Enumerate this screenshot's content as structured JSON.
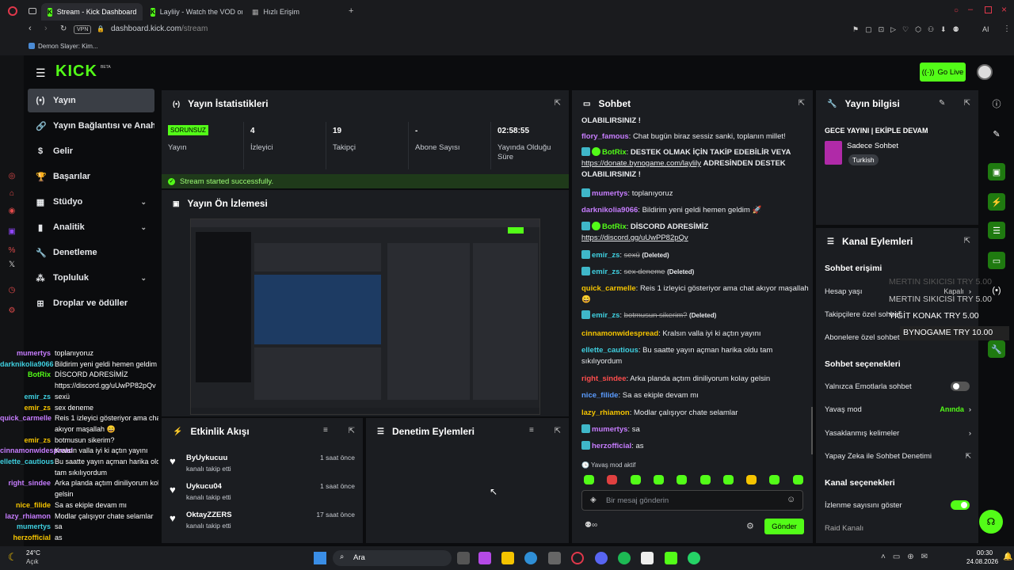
{
  "browser": {
    "tabs": [
      {
        "title": "Stream - Kick Dashboard"
      },
      {
        "title": "Layliiy - Watch the VOD on"
      },
      {
        "title": "Hızlı Erişim"
      }
    ],
    "vpn_label": "VPN",
    "url_domain": "dashboard.kick.com",
    "url_path": "/stream",
    "bookmark": "Demon Slayer: Kim...",
    "ai_label": "AI"
  },
  "app": {
    "logo": "KICK",
    "logo_beta": "BETA",
    "go_live": "Go Live",
    "accent": "#53fc18"
  },
  "nav": [
    {
      "label": "Yayın",
      "icon": "broadcast-icon"
    },
    {
      "label": "Yayın Bağlantısı ve Anahtarı",
      "icon": "link-icon"
    },
    {
      "label": "Gelir",
      "icon": "dollar-icon"
    },
    {
      "label": "Başarılar",
      "icon": "trophy-icon"
    },
    {
      "label": "Stüdyo",
      "icon": "studio-icon"
    },
    {
      "label": "Analitik",
      "icon": "analytics-icon"
    },
    {
      "label": "Denetleme",
      "icon": "wrench-icon"
    },
    {
      "label": "Topluluk",
      "icon": "community-icon"
    },
    {
      "label": "Droplar ve ödüller",
      "icon": "drops-icon"
    }
  ],
  "stats": {
    "title": "Yayın İstatistikleri",
    "items": [
      {
        "value": "SORUNSUZ",
        "label": "Yayın"
      },
      {
        "value": "4",
        "label": "İzleyici"
      },
      {
        "value": "19",
        "label": "Takipçi"
      },
      {
        "value": "-",
        "label": "Abone Sayısı"
      },
      {
        "value": "02:58:55",
        "label": "Yayında Olduğu Süre"
      }
    ],
    "success": "Stream started successfully."
  },
  "preview": {
    "title": "Yayın Ön İzlemesi"
  },
  "activity": {
    "title": "Etkinlik Akışı",
    "items": [
      {
        "name": "ByUykucuu",
        "desc": "kanalı takip etti",
        "time": "1 saat önce"
      },
      {
        "name": "Uykucu04",
        "desc": "kanalı takip etti",
        "time": "1 saat önce"
      },
      {
        "name": "OktayZZERS",
        "desc": "kanalı takip etti",
        "time": "17 saat önce"
      }
    ]
  },
  "mod_actions": {
    "title": "Denetim Eylemleri"
  },
  "chat": {
    "title": "Sohbet",
    "top_text": "OLABILIRSINIZ !",
    "messages": [
      {
        "user": "flory_famous",
        "color": "#c77dff",
        "text": "Chat bugün biraz sessiz sanki, toplanın millet!"
      },
      {
        "user": "BotRix",
        "color": "#53fc18",
        "text": "DESTEK OLMAK İÇİN TAKİP EDEBİLİR VEYA",
        "link": "https://donate.bynogame.com/laylily",
        "after": "ADRESİNDEN DESTEK OLABILIRSINIZ !"
      },
      {
        "user": "mumertys",
        "color": "#c77dff",
        "text": "toplanıyoruz"
      },
      {
        "user": "darknikolia9066",
        "color": "#c77dff",
        "text": "Bildirim yeni geldi hemen geldim 🚀"
      },
      {
        "user": "BotRix",
        "color": "#53fc18",
        "text": "DİSCORD ADRESİMİZ",
        "link": "https://discord.gg/uUwPP82pQv"
      },
      {
        "user": "emir_zs",
        "color": "#3fd0e0",
        "text": "sexü",
        "deleted": "(Deleted)"
      },
      {
        "user": "emir_zs",
        "color": "#3fd0e0",
        "text": "sex deneme",
        "deleted": "(Deleted)"
      },
      {
        "user": "quick_carmelle",
        "color": "#f5c400",
        "text": "Reis 1 izleyici gösteriyor ama chat akıyor maşallah 😄"
      },
      {
        "user": "emir_zs",
        "color": "#3fd0e0",
        "text": "botmusun sikerim?",
        "deleted": "(Deleted)"
      },
      {
        "user": "cinnamonwidespread",
        "color": "#f5c400",
        "text": "Kralsın valla iyi ki açtın yayını"
      },
      {
        "user": "ellette_cautious",
        "color": "#3fd0e0",
        "text": "Bu saatte yayın açman harika oldu tam sıkılıyordum"
      },
      {
        "user": "right_sindee",
        "color": "#ff4d4d",
        "text": "Arka planda açtım diniliyorum kolay gelsin"
      },
      {
        "user": "nice_filide",
        "color": "#5b9cff",
        "text": "Sa as ekiple devam mı"
      },
      {
        "user": "lazy_rhiamon",
        "color": "#f5c400",
        "text": "Modlar çalışıyor chate selamlar"
      },
      {
        "user": "mumertys",
        "color": "#c77dff",
        "text": "sa"
      },
      {
        "user": "herzofficial",
        "color": "#c77dff",
        "text": "as"
      }
    ],
    "slow_mode": "Yavaş mod aktif",
    "input_placeholder": "Bir mesaj gönderin",
    "send_label": "Gönder"
  },
  "stream_info": {
    "title": "Yayın bilgisi",
    "stream_title": "GECE YAYINI | EKİPLE DEVAM",
    "category": "Sadece Sohbet",
    "language": "Turkish"
  },
  "channel_actions": {
    "title": "Kanal Eylemleri",
    "chat_access": "Sohbet erişimi",
    "account_age": "Hesap yaşı",
    "account_age_value": "Kapalı",
    "followers_only": "Takipçilere özel sohbet",
    "subs_only": "Abonelere özel sohbet",
    "chat_options": "Sohbet seçenekleri",
    "emotes_only": "Yalnızca Emotlarla sohbet",
    "slow_mode": "Yavaş mod",
    "slow_mode_value": "Anında",
    "banned_words": "Yasaklanmış kelimeler",
    "ai_moderation": "Yapay Zeka ile Sohbet Denetimi",
    "channel_options": "Kanal seçenekleri",
    "show_viewers": "İzlenme sayısını göster",
    "raid": "Raid Kanalı"
  },
  "donations": [
    {
      "text": "MERTIN SIKICISI  TRY 5.00",
      "faded": true
    },
    {
      "text": "MERTIN SIKICISI  TRY 5.00",
      "faded": false
    },
    {
      "text": "YİĞİT KONAK  TRY 5.00",
      "faded": false
    },
    {
      "text": "BYNOGAME  TRY 10.00",
      "faded": false
    }
  ],
  "overlay_chat": [
    {
      "user": "mumertys",
      "text": "toplanıyoruz"
    },
    {
      "user": "darknikolia9066",
      "text": "Bildirim yeni geldi hemen geldim 🚀"
    },
    {
      "user": "BotRix",
      "text": "DİSCORD ADRESİMİZ"
    },
    {
      "user": "",
      "text": "https://discord.gg/uUwPP82pQv"
    },
    {
      "user": "emir_zs",
      "text": "sexü"
    },
    {
      "user": "emir_zs",
      "text": "sex deneme"
    },
    {
      "user": "quick_carmelle",
      "text": "Reis 1 izleyici gösteriyor ama chat"
    },
    {
      "user": "",
      "text": "akıyor maşallah 😄"
    },
    {
      "user": "emir_zs",
      "text": "botmusun sikerim?"
    },
    {
      "user": "cinnamonwidespread",
      "text": "Kralsın valla iyi ki açtın yayını"
    },
    {
      "user": "ellette_cautious",
      "text": "Bu saatte yayın açman harika oldu"
    },
    {
      "user": "",
      "text": "tam sıkılıyordum"
    },
    {
      "user": "right_sindee",
      "text": "Arka planda açtım diniliyorum kolay"
    },
    {
      "user": "",
      "text": "gelsin"
    },
    {
      "user": "nice_filide",
      "text": "Sa as ekiple devam mı"
    },
    {
      "user": "lazy_rhiamon",
      "text": "Modlar çalışıyor chate selamlar"
    },
    {
      "user": "mumertys",
      "text": "sa"
    },
    {
      "user": "herzofficial",
      "text": "as"
    }
  ],
  "taskbar": {
    "weather_temp": "24°C",
    "weather_desc": "Açık",
    "search": "Ara",
    "time": "00:30",
    "date": "24.08.2026"
  }
}
